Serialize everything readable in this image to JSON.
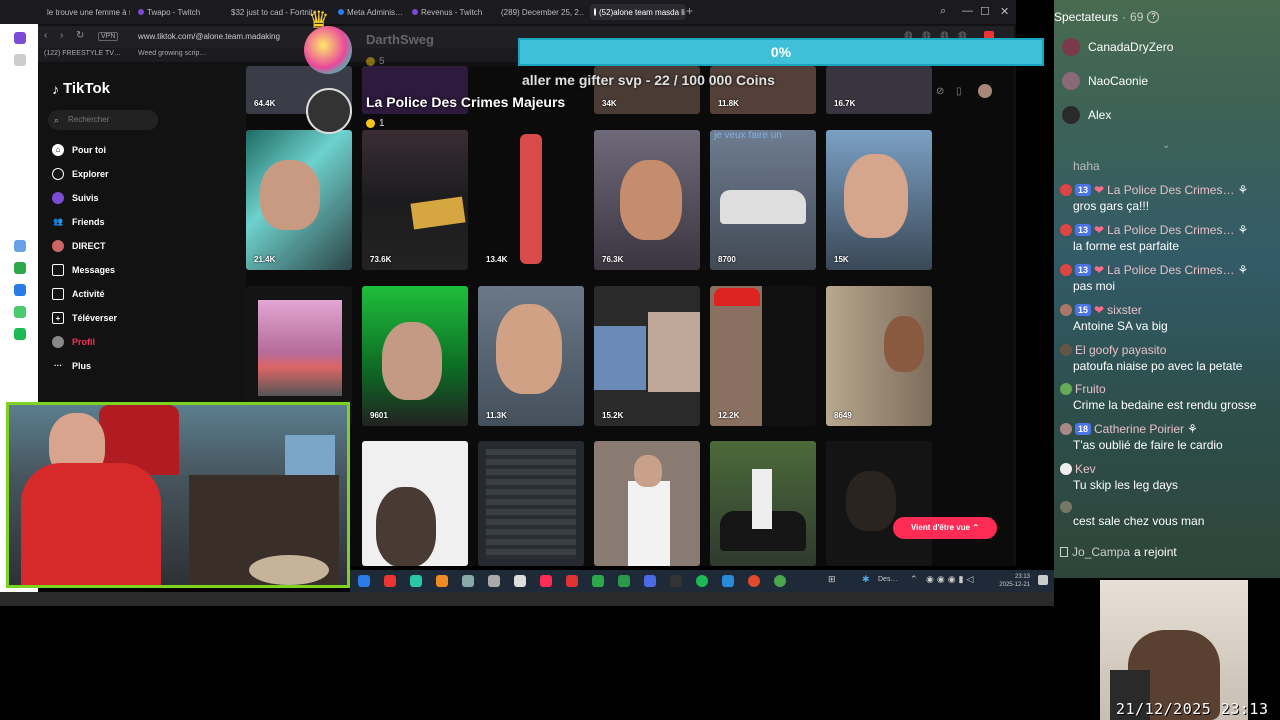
{
  "browser": {
    "tabs": [
      "le trouve une femme à sa…",
      "Twapo - Twitch",
      "$32 just to cad - Fortnite",
      "Meta Adminis…",
      "Revenus - Twitch",
      "(289) December 25, 2…",
      "(52)alone team masda li…"
    ],
    "url": "www.tiktok.com/@alone.team.madaking",
    "bookmarks": [
      "(122) FREESTYLE TV…",
      "Weed growing scrip…"
    ]
  },
  "tiktok": {
    "logo": "TikTok",
    "search_placeholder": "Rechercher",
    "nav": [
      {
        "label": "Pour toi",
        "icon": "home-icon"
      },
      {
        "label": "Explorer",
        "icon": "compass-icon"
      },
      {
        "label": "Suivis",
        "icon": "following-icon"
      },
      {
        "label": "Friends",
        "icon": "friends-icon"
      },
      {
        "label": "DIRECT",
        "icon": "live-icon"
      },
      {
        "label": "Messages",
        "icon": "messages-icon"
      },
      {
        "label": "Activité",
        "icon": "activity-icon"
      },
      {
        "label": "Téléverser",
        "icon": "upload-icon"
      },
      {
        "label": "Profil",
        "icon": "profile-icon"
      },
      {
        "label": "Plus",
        "icon": "more-icon"
      }
    ],
    "top_row_views": [
      "64.4K",
      "",
      "34K",
      "11.8K",
      "16.7K"
    ],
    "rows": [
      [
        "21.4K",
        "73.6K",
        "13.4K",
        "76.3K",
        "8700",
        "15K"
      ],
      [
        "",
        "9601",
        "11.3K",
        "15.2K",
        "12.2K",
        "8649"
      ],
      [
        "",
        "",
        "",
        "",
        "",
        ""
      ]
    ],
    "thumb_text": "je veux faire un",
    "live_button": "Vient d'être vue"
  },
  "overlay": {
    "goal_percent": "0%",
    "goal_text": "aller me gifter svp - 22 / 100 000 Coins",
    "alert_user": "DarthSweg",
    "alert_coins": "5",
    "gifter_name": "La Police Des Crimes Majeurs",
    "gifter_coins": "1"
  },
  "taskbar": {
    "search_label": "Des…",
    "time": "23:13",
    "date": "2025-12-21"
  },
  "chat": {
    "title": "Spectateurs",
    "viewer_count": "69",
    "viewers": [
      "CanadaDryZero",
      "NaoCaonie",
      "Alex"
    ],
    "messages": [
      {
        "user": "",
        "text": "haha"
      },
      {
        "level": "13",
        "user": "La Police Des Crimes…",
        "text": "gros gars ça!!!"
      },
      {
        "level": "13",
        "user": "La Police Des Crimes…",
        "text": "la forme est parfaite"
      },
      {
        "level": "13",
        "user": "La Police Des Crimes…",
        "text": "pas moi"
      },
      {
        "level": "15",
        "user": "sixster",
        "text": "Antoine SA va big"
      },
      {
        "user": "El goofy payasito",
        "text": "patoufa niaise po avec la petate"
      },
      {
        "user": "Fruito",
        "text": "Crime la bedaine est rendu grosse"
      },
      {
        "level": "18",
        "user": "Catherine Poirier",
        "text": "T'as oublié de faire le cardio"
      },
      {
        "user": "Kev",
        "text": "Tu skip les leg days"
      },
      {
        "user": "",
        "text": "cest sale chez vous man"
      }
    ],
    "join_user": "Jo_Campa",
    "join_text": "a rejoint"
  },
  "stream": {
    "timestamp": "21/12/2025 23:13"
  },
  "colors": {
    "goal_bar": "#3fc0d8",
    "webcam_border": "#7ed321",
    "tiktok_red": "#fe2c55",
    "level_badge": "#4a74e8"
  }
}
